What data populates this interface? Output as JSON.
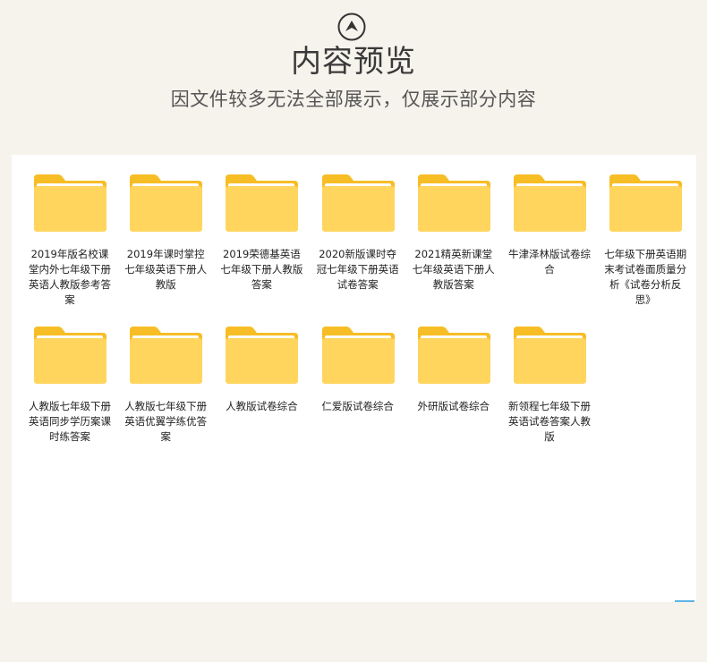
{
  "header": {
    "title": "内容预览",
    "subtitle": "因文件较多无法全部展示，仅展示部分内容",
    "logo_icon": "chevron-up-circle-icon"
  },
  "colors": {
    "background": "#f6f3ec",
    "panel": "#ffffff",
    "folder_back": "#f7bd25",
    "folder_front": "#ffd55e",
    "folder_paper": "#ffffff"
  },
  "folders": [
    {
      "label": "2019年版名校课堂内外七年级下册英语人教版参考答案",
      "icon": "folder-icon"
    },
    {
      "label": "2019年课时掌控七年级英语下册人教版",
      "icon": "folder-icon"
    },
    {
      "label": "2019荣德基英语七年级下册人教版答案",
      "icon": "folder-icon"
    },
    {
      "label": "2020新版课时夺冠七年级下册英语试卷答案",
      "icon": "folder-icon"
    },
    {
      "label": "2021精英新课堂七年级英语下册人教版答案",
      "icon": "folder-icon"
    },
    {
      "label": "牛津泽林版试卷综合",
      "icon": "folder-icon"
    },
    {
      "label": "七年级下册英语期末考试卷面质量分析《试卷分析反思》",
      "icon": "folder-icon"
    },
    {
      "label": "人教版七年级下册英语同步学历案课时练答案",
      "icon": "folder-icon"
    },
    {
      "label": "人教版七年级下册英语优翼学练优答案",
      "icon": "folder-icon"
    },
    {
      "label": "人教版试卷综合",
      "icon": "folder-icon"
    },
    {
      "label": "仁爱版试卷综合",
      "icon": "folder-icon"
    },
    {
      "label": "外研版试卷综合",
      "icon": "folder-icon"
    },
    {
      "label": "新领程七年级下册英语试卷答案人教版",
      "icon": "folder-icon"
    }
  ]
}
